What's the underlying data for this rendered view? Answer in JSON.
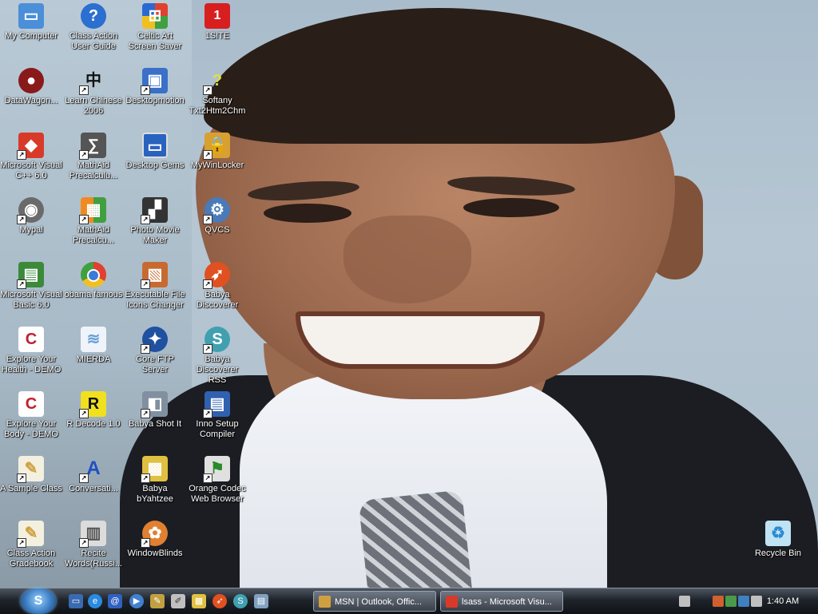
{
  "desktop": {
    "icons": [
      {
        "label": "My Computer",
        "icon": "computer-icon",
        "color": "#4a8fd8"
      },
      {
        "label": "Class Action User Guide",
        "icon": "help-icon",
        "color": "#2b6fd0"
      },
      {
        "label": "Celtic Art Screen Saver",
        "icon": "windows-flag-icon",
        "color": "#e0a020"
      },
      {
        "label": "1SITE",
        "icon": "1site-icon",
        "color": "#d81f1f"
      },
      {
        "label": "DataWagon...",
        "icon": "datawagon-icon",
        "color": "#8a1a1a"
      },
      {
        "label": "Learn Chinese 2006",
        "icon": "chinese-character-icon",
        "color": "#222222"
      },
      {
        "label": "Desktopmotion",
        "icon": "desktopmotion-icon",
        "color": "#3a70c8"
      },
      {
        "label": "Softany Txt2Htm2Chm",
        "icon": "softany-icon",
        "color": "#c8c840"
      },
      {
        "label": "Microsoft Visual C++ 6.0",
        "icon": "visual-cpp-icon",
        "color": "#d83a2a"
      },
      {
        "label": "MathAid Precalculu...",
        "icon": "mathaid-icon",
        "color": "#555555"
      },
      {
        "label": "Desktop Gems",
        "icon": "monitor-icon",
        "color": "#2a62c0"
      },
      {
        "label": "MyWinLocker",
        "icon": "lock-icon",
        "color": "#d8a030"
      },
      {
        "label": "Mypal",
        "icon": "raccoon-icon",
        "color": "#6a6a6a"
      },
      {
        "label": "MathAid Precalcu...",
        "icon": "mathaid-blocks-icon",
        "color": "#f08a20"
      },
      {
        "label": "Photo Movie Maker",
        "icon": "clapper-icon",
        "color": "#333333"
      },
      {
        "label": "QVCS",
        "icon": "qvcs-icon",
        "color": "#4a7ab8"
      },
      {
        "label": "Microsoft Visual Basic 6.0",
        "icon": "visual-basic-icon",
        "color": "#3a8a3a"
      },
      {
        "label": "obama famous",
        "icon": "chrome-icon",
        "color": "#e04030"
      },
      {
        "label": "Executable File Icons Changer",
        "icon": "exe-changer-icon",
        "color": "#c86a30"
      },
      {
        "label": "Babya Discoverer",
        "icon": "rocket-icon",
        "color": "#e05020"
      },
      {
        "label": "Explore Your Health - DEMO",
        "icon": "explore-c-icon",
        "color": "#c02030"
      },
      {
        "label": "MIERDA",
        "icon": "document-icon",
        "color": "#6aa0d8"
      },
      {
        "label": "Core FTP Server",
        "icon": "coreftp-icon",
        "color": "#2050a0"
      },
      {
        "label": "Babya Discoverer RSS",
        "icon": "babya-rss-icon",
        "color": "#40a0b0"
      },
      {
        "label": "Explore Your Body - DEMO",
        "icon": "explore-c-icon",
        "color": "#c02030"
      },
      {
        "label": "R Decode 1.0",
        "icon": "rdecode-icon",
        "color": "#f0e020"
      },
      {
        "label": "Babya Shot It",
        "icon": "camera-icon",
        "color": "#8090a0"
      },
      {
        "label": "Inno Setup Compiler",
        "icon": "inno-setup-icon",
        "color": "#3060b0"
      },
      {
        "label": "A Sample Class",
        "icon": "sample-class-icon",
        "color": "#d0a040"
      },
      {
        "label": "Conversati...",
        "icon": "conversation-icon",
        "color": "#2050c0"
      },
      {
        "label": "Babya bYahtzee",
        "icon": "yahtzee-icon",
        "color": "#e0c040"
      },
      {
        "label": "Orange Codec Web Browser",
        "icon": "orange-codec-icon",
        "color": "#e0e0e0"
      },
      {
        "label": "Class Action Gradebook",
        "icon": "gradebook-icon",
        "color": "#d0a040"
      },
      {
        "label": "Recite Words(Russi...",
        "icon": "recite-words-icon",
        "color": "#8a8a8a"
      },
      {
        "label": "WindowBlinds",
        "icon": "palette-icon",
        "color": "#e08030"
      },
      {
        "label": "Recycle Bin",
        "icon": "recycle-bin-icon",
        "color": "#6ab0e0"
      }
    ]
  },
  "taskbar": {
    "start_label": "",
    "quick_launch": [
      {
        "icon": "show-desktop-icon",
        "color": "#3a6ab0"
      },
      {
        "icon": "ie-icon",
        "color": "#2a8ae0"
      },
      {
        "icon": "outlook-icon",
        "color": "#3060c0"
      },
      {
        "icon": "media-player-icon",
        "color": "#4080d0"
      },
      {
        "icon": "notepad-icon",
        "color": "#c0a040"
      },
      {
        "icon": "pen-icon",
        "color": "#c0c0c0"
      },
      {
        "icon": "yahtzee-icon",
        "color": "#e0c040"
      },
      {
        "icon": "rocket-icon",
        "color": "#e05020"
      },
      {
        "icon": "babya-rss-icon",
        "color": "#40a0b0"
      },
      {
        "icon": "window-icon",
        "color": "#80a0c0"
      }
    ],
    "tasks": [
      {
        "label": "MSN | Outlook, Offic...",
        "icon": "msn-icon",
        "color": "#d0a040"
      },
      {
        "label": "lsass - Microsoft Visu...",
        "icon": "visual-cpp-icon",
        "color": "#d83a2a"
      }
    ],
    "tray_icons": [
      {
        "icon": "keyboard-icon",
        "color": "#c0c0c0"
      },
      {
        "icon": "network-icon",
        "color": "#d06030"
      },
      {
        "icon": "volume-icon",
        "color": "#4a9a4a"
      },
      {
        "icon": "security-icon",
        "color": "#4080c0"
      },
      {
        "icon": "speaker-icon",
        "color": "#c0c0c0"
      }
    ],
    "clock": "1:40 AM"
  }
}
